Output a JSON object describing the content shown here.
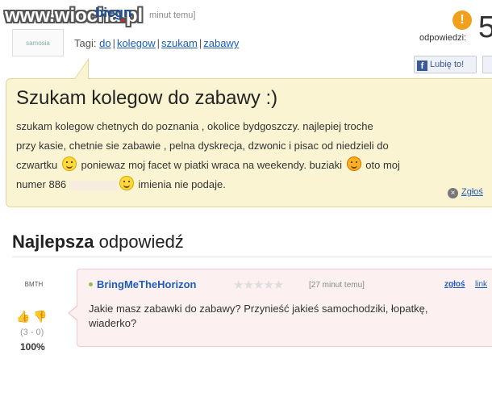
{
  "watermark": {
    "prefix": "www.",
    "brand": "wiocha",
    "dot": ".",
    "tld": "pl"
  },
  "question_header": {
    "avatar_label": "samosia",
    "nickname": "biegn",
    "time": "minut temu]",
    "tags_label": "Tagi:",
    "tags": [
      "do",
      "kolegow",
      "szukam",
      "zabawy"
    ],
    "answers_label": "odpowiedzi:",
    "answers_badge": "!",
    "answers_count": "5",
    "like_label": "Lubię to!",
    "fb_icon": "f"
  },
  "question": {
    "title": "Szukam kolegow do zabawy :)",
    "line1": "szukam kolegow chetnych do poznania , okolice bydgoszczy. najlepiej troche",
    "line2": "przy kasie, chetnie sie zabawie , pelna dyskrecja, dzwonic i pisac od niedzieli do",
    "line3a": "czwartku",
    "line3b": "poniewaz moj facet w piatki wraca na weekendy. buziaki",
    "line3c": "oto moj",
    "line4a": "numer 886",
    "line4b": "imienia nie podaje.",
    "report_label": "Zgłoś",
    "report_icon": "×"
  },
  "best_answer": {
    "heading_bold": "Najlepsza",
    "heading_rest": " odpowiedź",
    "avatar_label": "BMTH",
    "thumbs": "👍 👎",
    "votes": "(3 - 0)",
    "percent": "100%",
    "username": "BringMeTheHorizon",
    "stars": "★★★★★",
    "time": "[27 minut temu]",
    "report_label": "zgłoś",
    "link_label": "link",
    "text": "Jakie masz zabawki do zabawy? Przynieść jakieś samochodziki, łopatkę, wiaderko?"
  }
}
